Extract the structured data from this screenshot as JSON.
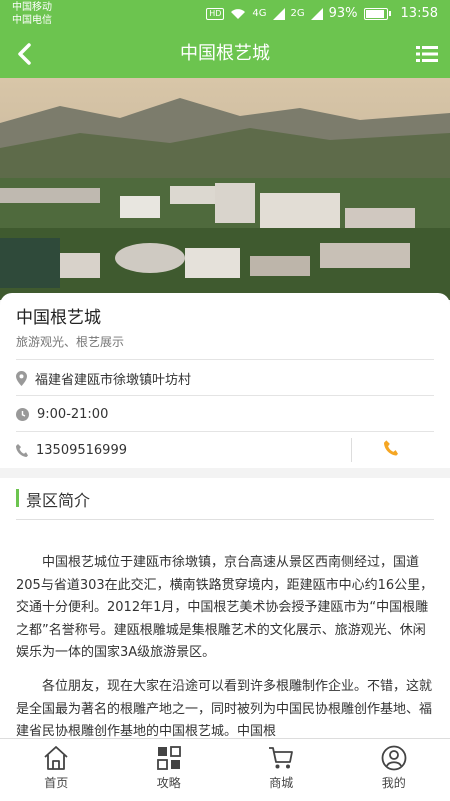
{
  "status": {
    "carrier1": "中国移动",
    "carrier2": "中国电信",
    "hd": "HD",
    "sig1": "4G",
    "sig2": "2G",
    "battery": "93%",
    "time": "13:58"
  },
  "nav": {
    "title": "中国根艺城"
  },
  "place": {
    "name": "中国根艺城",
    "tags": "旅游观光、根艺展示",
    "address": "福建省建瓯市徐墩镇叶坊村",
    "hours": "9:00-21:00",
    "phone": "13509516999"
  },
  "intro": {
    "title": "景区简介",
    "p1": "中国根艺城位于建瓯市徐墩镇，京台高速从景区西南侧经过，国道205与省道303在此交汇，横南铁路贯穿境内，距建瓯市中心约16公里，交通十分便利。2012年1月，中国根艺美术协会授予建瓯市为“中国根雕之都”名誉称号。建瓯根雕城是集根雕艺术的文化展示、旅游观光、休闲娱乐为一体的国家3A级旅游景区。",
    "p2": "各位朋友，现在大家在沿途可以看到许多根雕制作企业。不错，这就是全国最为著名的根雕产地之一，同时被列为中国民协根雕创作基地、福建省民协根雕创作基地的中国根艺城。中国根"
  },
  "tabs": [
    {
      "label": "首页",
      "icon": "home-icon"
    },
    {
      "label": "攻略",
      "icon": "grid-icon"
    },
    {
      "label": "商城",
      "icon": "cart-icon"
    },
    {
      "label": "我的",
      "icon": "user-icon"
    }
  ],
  "colors": {
    "accent": "#6cc44f",
    "phone_icon": "#f5a623"
  }
}
